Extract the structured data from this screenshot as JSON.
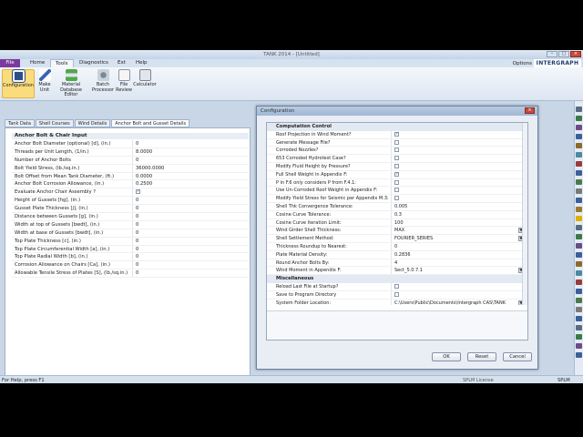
{
  "window": {
    "title": "TANK 2014 - [Untitled]"
  },
  "ribbon_tabs": [
    "File",
    "Home",
    "Tools",
    "Diagnostics",
    "Ext",
    "Help"
  ],
  "ribbon_active_tab": "Tools",
  "options_label": "Options",
  "brand": "INTERGRAPH",
  "ribbon_buttons": [
    {
      "label": "Configuration",
      "icon": "configuration-icon"
    },
    {
      "label": "Make Unit",
      "icon": "make-unit-icon"
    },
    {
      "label": "Material Database Editor",
      "icon": "material-database-icon"
    },
    {
      "label": "Batch Processor",
      "icon": "batch-processor-icon"
    },
    {
      "label": "File Review",
      "icon": "file-review-icon"
    },
    {
      "label": "Calculator",
      "icon": "calculator-icon"
    }
  ],
  "doc_tabs": [
    "Tank Data",
    "Shell Courses",
    "Wind Details",
    "Anchor Bolt and Gusset Details"
  ],
  "doc_active_tab": "Anchor Bolt and Gusset Details",
  "anchor_grid": {
    "caption": "Anchor Bolt & Chair Input",
    "rows": [
      {
        "label": "Anchor Bolt Diameter (optional) [d], (in.)",
        "value": "0"
      },
      {
        "label": "Threads per Unit Length, (1/in.)",
        "value": "8.0000"
      },
      {
        "label": "Number of Anchor Bolts",
        "value": "0"
      },
      {
        "label": "Bolt Yield Stress, (lb./sq.in.)",
        "value": "36000.0000"
      },
      {
        "label": "Bolt Offset from Mean Tank Diameter, (ft.)",
        "value": "0.0000"
      },
      {
        "label": "Anchor Bolt Corrosion Allowance, (in.)",
        "value": "0.2500"
      },
      {
        "label": "Evaluate Anchor Chair Assembly ?",
        "value": "",
        "checked": true
      },
      {
        "label": "Height of Gussets [hg], (in.)",
        "value": "0"
      },
      {
        "label": "Gusset Plate Thickness [j], (in.)",
        "value": "0"
      },
      {
        "label": "Distance between Gussets [g], (in.)",
        "value": "0"
      },
      {
        "label": "Width at top of Gussets [bwdt], (in.)",
        "value": "0"
      },
      {
        "label": "Width at base of Gussets [bwdt], (in.)",
        "value": "0"
      },
      {
        "label": "Top Plate Thickness [c], (in.)",
        "value": "0"
      },
      {
        "label": "Top Plate Circumferential Width [a], (in.)",
        "value": "0"
      },
      {
        "label": "Top Plate Radial Width [b], (in.)",
        "value": "0"
      },
      {
        "label": "Corrosion Allowance on Chairs [Ca], (in.)",
        "value": "0"
      },
      {
        "label": "Allowable Tensile Stress of Plates [S], (lb./sq.in.)",
        "value": "0"
      }
    ]
  },
  "dialog": {
    "title": "Configuration",
    "sections": [
      {
        "name": "Computation Control",
        "rows": [
          {
            "label": "Roof Projection in Wind Moment?",
            "value": "",
            "checked": true
          },
          {
            "label": "Generate Message File?",
            "value": "",
            "checked": false
          },
          {
            "label": "Corroded Nozzles?",
            "value": "",
            "checked": false
          },
          {
            "label": "653 Corroded Hydrotest Case?",
            "value": "",
            "checked": false
          },
          {
            "label": "Modify Fluid Height by Pressure?",
            "value": "",
            "checked": false
          },
          {
            "label": "Full Shell Weight in Appendix F:",
            "value": "",
            "checked": true
          },
          {
            "label": "P in F.6 only considers P from F.4.1:",
            "value": "",
            "checked": false
          },
          {
            "label": "Use Un-Corroded Roof Weight in Appendix F:",
            "value": "",
            "checked": false
          },
          {
            "label": "Modify Yield Stress for Seismic per Appendix M.3:",
            "value": "",
            "checked": false
          },
          {
            "label": "Shell Thk Convergence Tolerance:",
            "value": "0.005"
          },
          {
            "label": "Cosine Curve Tolerance:",
            "value": "0.3"
          },
          {
            "label": "Cosine Curve Iteration Limit:",
            "value": "100"
          },
          {
            "label": "Wind Girder Shell Thickness:",
            "value": "MAX",
            "dropdown": true
          },
          {
            "label": "Shell Settlement Method:",
            "value": "FOURIER_SERIES",
            "dropdown": true
          },
          {
            "label": "Thickness Roundup to Nearest:",
            "value": "0"
          },
          {
            "label": "Plate Material Density:",
            "value": "0.2836"
          },
          {
            "label": "Round Anchor Bolts By:",
            "value": "4"
          },
          {
            "label": "Wind Moment in Appendix F:",
            "value": "Sect_5.0.7.1",
            "dropdown": true
          }
        ]
      },
      {
        "name": "Miscellaneous",
        "rows": [
          {
            "label": "Reload Last File at Startup?",
            "value": "",
            "checked": false
          },
          {
            "label": "Save to Program Directory",
            "value": "",
            "checked": false
          },
          {
            "label": "System Folder Location:",
            "value": "C:\\Users\\Public\\Documents\\Intergraph CAS\\TANK",
            "dropdown": true
          }
        ]
      }
    ],
    "buttons": {
      "ok": "OK",
      "reset": "Reset",
      "cancel": "Cancel"
    }
  },
  "status": {
    "help": "For Help, press F1",
    "license": "SPLM License",
    "units": "SPLM"
  }
}
